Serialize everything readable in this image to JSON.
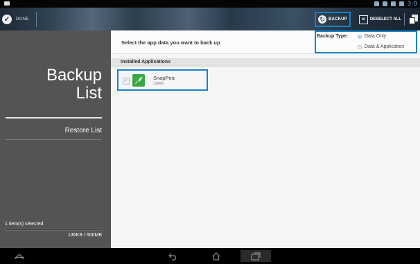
{
  "statusbar": {
    "time": "3:0"
  },
  "actionbar": {
    "done_label": "DONE",
    "backup_label": "BACKUP",
    "deselect_label": "DESELECT ALL"
  },
  "sidebar": {
    "title_line1": "Backup",
    "title_line2": "List",
    "restore_label": "Restore List",
    "selected_count": "1 item(s) selected",
    "storage_text": "136KB / 600MB",
    "storage_fraction": 0.0002
  },
  "main": {
    "prompt": "Select the app data you want to back up",
    "backup_type_label": "Backup Type:",
    "options": [
      {
        "label": "Data Only",
        "selected": true
      },
      {
        "label": "Data & Application",
        "selected": false
      }
    ],
    "section_label": "Installed Applications",
    "apps": [
      {
        "name": "SnapPea",
        "size": "136KB",
        "checked": true,
        "icon": "snappea-app-icon"
      }
    ]
  },
  "colors": {
    "accent": "#1a82c8",
    "sidebar": "#545454"
  },
  "navbar": {
    "icons": [
      "collapse-icon",
      "back-icon",
      "home-icon",
      "recent-apps-icon"
    ]
  }
}
